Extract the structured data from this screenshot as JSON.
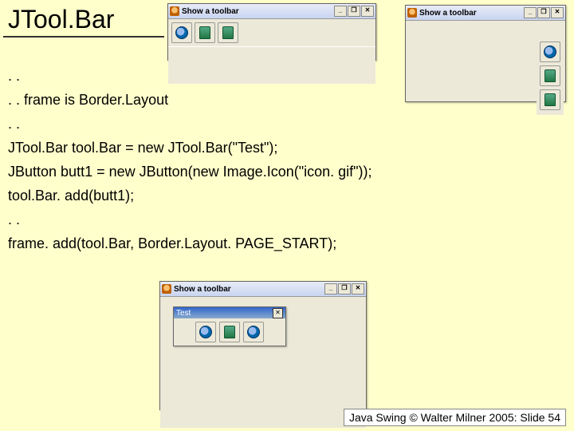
{
  "title": "JTool.Bar",
  "code": {
    "l1": ". .",
    "l2": ". . frame is Border.Layout",
    "l3": ". .",
    "l4": "JTool.Bar tool.Bar = new JTool.Bar(\"Test\");",
    "l5": "JButton butt1 = new JButton(new Image.Icon(\"icon. gif\"));",
    "l6": "tool.Bar. add(butt1);",
    "l7": ". .",
    "l8": "frame. add(tool.Bar, Border.Layout. PAGE_START);"
  },
  "footer": "Java Swing © Walter Milner 2005: Slide 54",
  "windows": {
    "win1": {
      "title": "Show a toolbar"
    },
    "win2": {
      "title": "Show a toolbar"
    },
    "win3": {
      "title": "Show a toolbar",
      "float_title": "Test"
    }
  },
  "win_controls": {
    "min": "_",
    "max": "❐",
    "close": "✕"
  }
}
